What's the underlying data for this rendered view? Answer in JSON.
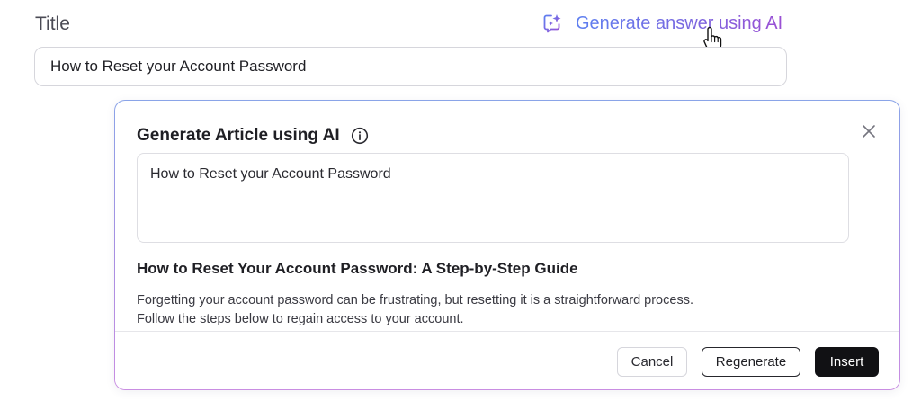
{
  "form": {
    "title_label": "Title",
    "title_value": "How to Reset your Account Password",
    "ai_link_label": "Generate answer using AI"
  },
  "modal": {
    "title": "Generate Article using AI",
    "prompt_value": "How to Reset your Account Password",
    "result_heading": "How to Reset Your Account Password: A Step-by-Step Guide",
    "result_lines": [
      "Forgetting your account password can be frustrating, but resetting it is a straightforward process.",
      "Follow the steps below to regain access to your account."
    ],
    "buttons": {
      "cancel": "Cancel",
      "regenerate": "Regenerate",
      "insert": "Insert"
    }
  },
  "icons": {
    "ai": "sparkle-chat-icon",
    "info": "info-icon",
    "close": "close-icon",
    "cursor": "hand-pointer-icon"
  },
  "colors": {
    "ai_gradient_start": "#5d7ff0",
    "ai_gradient_end": "#9b4fd4",
    "primary_button": "#111114"
  }
}
